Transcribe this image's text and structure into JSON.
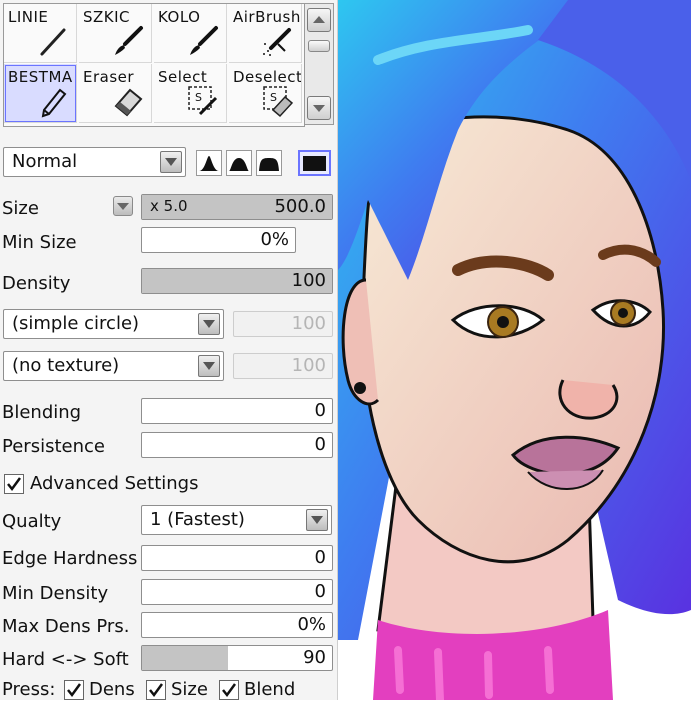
{
  "tools": [
    {
      "label": "LINIE",
      "icon": "pen-icon"
    },
    {
      "label": "SZKIC",
      "icon": "brush-icon"
    },
    {
      "label": "KOLO",
      "icon": "brush-icon"
    },
    {
      "label": "AirBrush",
      "icon": "airbrush-icon"
    },
    {
      "label": "BESTMA",
      "icon": "pencil-icon"
    },
    {
      "label": "Eraser",
      "icon": "eraser-icon"
    },
    {
      "label": "Select",
      "icon": "select-icon"
    },
    {
      "label": "Deselect",
      "icon": "deselect-icon"
    }
  ],
  "blend_mode": "Normal",
  "size": {
    "label": "Size",
    "multiplier": "x 5.0",
    "value": "500.0"
  },
  "min_size": {
    "label": "Min Size",
    "value": "0%"
  },
  "density": {
    "label": "Density",
    "value": "100",
    "level": 1.0
  },
  "shape": {
    "value": "(simple circle)",
    "amount": "100"
  },
  "texture": {
    "value": "(no texture)",
    "amount": "100"
  },
  "blending": {
    "label": "Blending",
    "value": "0"
  },
  "persistence": {
    "label": "Persistence",
    "value": "0"
  },
  "advanced": {
    "label": "Advanced Settings"
  },
  "quality": {
    "label": "Qualty",
    "value": "1 (Fastest)"
  },
  "edge_hardness": {
    "label": "Edge Hardness",
    "value": "0"
  },
  "min_density": {
    "label": "Min Density",
    "value": "0"
  },
  "max_dens_prs": {
    "label": "Max Dens Prs.",
    "value": "0%"
  },
  "hard_soft": {
    "label": "Hard <-> Soft",
    "value": "90",
    "level": 0.45
  },
  "press": {
    "label": "Press:",
    "dens": "Dens",
    "size": "Size",
    "blend": "Blend"
  },
  "colors": {
    "selection": "#d9dcff",
    "accent": "#6b74ff",
    "hair_blue": "#2ec7f0",
    "hair_purple": "#5a2fe0"
  }
}
